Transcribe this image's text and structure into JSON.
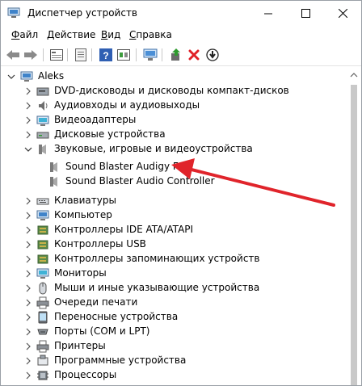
{
  "window": {
    "title": "Диспетчер устройств",
    "controls": {
      "minimize": "minimize",
      "maximize": "maximize",
      "close": "close"
    }
  },
  "menu": [
    {
      "label": "Файл",
      "hotkey": "Ф",
      "rest": "айл"
    },
    {
      "label": "Действие",
      "hotkey": "Д",
      "rest": "ействие"
    },
    {
      "label": "Вид",
      "hotkey": "В",
      "rest": "ид"
    },
    {
      "label": "Справка",
      "hotkey": "С",
      "rest": "правка"
    }
  ],
  "toolbar": {
    "buttons": [
      "back-icon",
      "forward-icon",
      "show-hidden-icon",
      "properties-icon",
      "help-icon",
      "action-pane-icon",
      "monitor-scan-icon",
      "update-driver-icon",
      "uninstall-icon",
      "disable-icon"
    ]
  },
  "tree": {
    "root": "Aleks",
    "categories": [
      {
        "label": "DVD-дисководы и дисководы компакт-дисков",
        "icon": "dvd-drive-icon",
        "expanded": false
      },
      {
        "label": "Аудиовходы и аудиовыходы",
        "icon": "audio-io-icon",
        "expanded": false
      },
      {
        "label": "Видеоадаптеры",
        "icon": "display-adapter-icon",
        "expanded": false
      },
      {
        "label": "Дисковые устройства",
        "icon": "disk-drive-icon",
        "expanded": false
      },
      {
        "label": "Звуковые, игровые и видеоустройства",
        "icon": "sound-icon",
        "expanded": true,
        "children": [
          {
            "label": "Sound Blaster Audigy Fx",
            "icon": "speaker-icon"
          },
          {
            "label": "Sound Blaster Audio Controller",
            "icon": "speaker-icon"
          }
        ]
      },
      {
        "label": "Клавиатуры",
        "icon": "keyboard-icon",
        "expanded": false
      },
      {
        "label": "Компьютер",
        "icon": "computer-icon",
        "expanded": false
      },
      {
        "label": "Контроллеры IDE ATA/ATAPI",
        "icon": "ide-controller-icon",
        "expanded": false
      },
      {
        "label": "Контроллеры USB",
        "icon": "usb-controller-icon",
        "expanded": false
      },
      {
        "label": "Контроллеры запоминающих устройств",
        "icon": "storage-controller-icon",
        "expanded": false
      },
      {
        "label": "Мониторы",
        "icon": "monitor-icon",
        "expanded": false
      },
      {
        "label": "Мыши и иные указывающие устройства",
        "icon": "mouse-icon",
        "expanded": false
      },
      {
        "label": "Очереди печати",
        "icon": "print-queue-icon",
        "expanded": false
      },
      {
        "label": "Переносные устройства",
        "icon": "portable-device-icon",
        "expanded": false
      },
      {
        "label": "Порты (COM и LPT)",
        "icon": "port-icon",
        "expanded": false
      },
      {
        "label": "Принтеры",
        "icon": "printer-icon",
        "expanded": false
      },
      {
        "label": "Программные устройства",
        "icon": "software-device-icon",
        "expanded": false
      },
      {
        "label": "Процессоры",
        "icon": "processor-icon",
        "expanded": false
      }
    ]
  },
  "annotation": {
    "arrow_color": "#e0242b"
  }
}
